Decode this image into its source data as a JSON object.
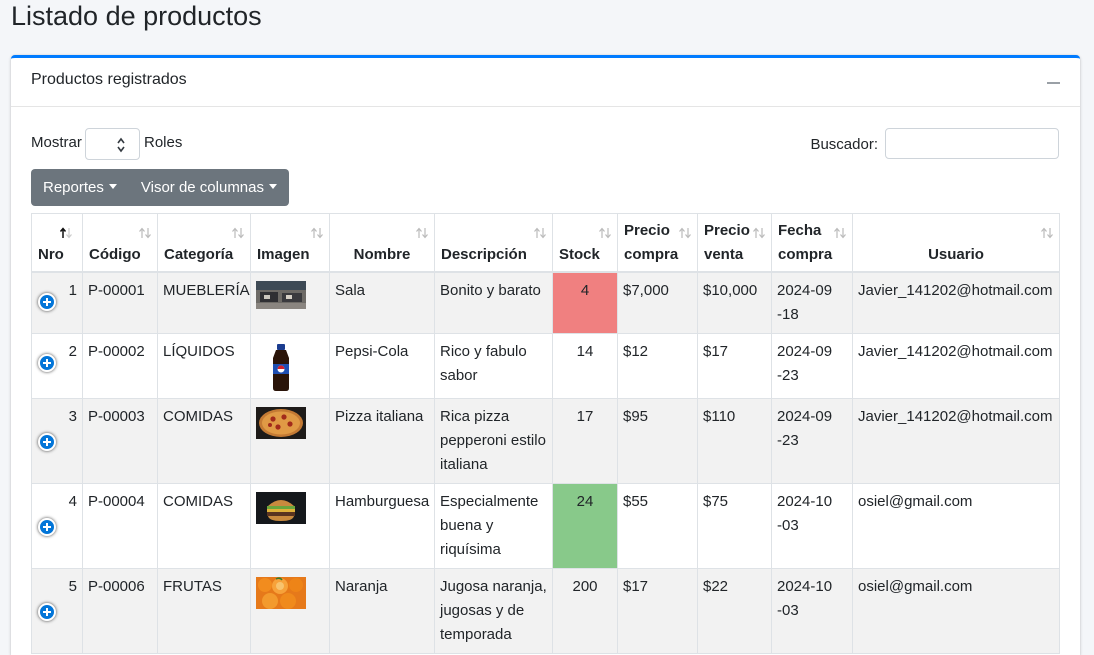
{
  "page": {
    "title": "Listado de productos"
  },
  "card": {
    "title": "Productos registrados"
  },
  "controls": {
    "show_label": "Mostrar",
    "roles_label": "Roles",
    "search_label": "Buscador:",
    "search_value": ""
  },
  "buttons": {
    "reports": "Reportes",
    "column_viewer": "Visor de columnas"
  },
  "colors": {
    "accent": "#007bff",
    "btn": "#6c757d",
    "stock_low": "#f08080",
    "stock_high": "#88c98a"
  },
  "table": {
    "headers": {
      "nro": "Nro",
      "codigo": "Código",
      "categoria": "Categoría",
      "imagen": "Imagen",
      "nombre": "Nombre",
      "descripcion": "Descripción",
      "stock": "Stock",
      "precio_compra_1": "Precio",
      "precio_compra_2": "compra",
      "precio_venta_1": "Precio",
      "precio_venta_2": "venta",
      "fecha_compra_1": "Fecha",
      "fecha_compra_2": "compra",
      "usuario": "Usuario"
    },
    "rows": [
      {
        "nro": "1",
        "codigo": "P-00001",
        "categoria": "MUEBLERÍA",
        "image": "sofa-image",
        "nombre": "Sala",
        "descripcion": "Bonito y barato",
        "stock": "4",
        "stock_state": "low",
        "precio_compra": "$7,000",
        "precio_venta": "$10,000",
        "fecha": "2024-09-18",
        "usuario": "Javier_141202@hotmail.com"
      },
      {
        "nro": "2",
        "codigo": "P-00002",
        "categoria": "LÍQUIDOS",
        "image": "bottle-image",
        "nombre": "Pepsi-Cola",
        "descripcion": "Rico y fabulo sabor",
        "stock": "14",
        "stock_state": "normal",
        "precio_compra": "$12",
        "precio_venta": "$17",
        "fecha": "2024-09-23",
        "usuario": "Javier_141202@hotmail.com"
      },
      {
        "nro": "3",
        "codigo": "P-00003",
        "categoria": "COMIDAS",
        "image": "pizza-image",
        "nombre": "Pizza italiana",
        "descripcion": "Rica pizza pepperoni estilo italiana",
        "stock": "17",
        "stock_state": "normal",
        "precio_compra": "$95",
        "precio_venta": "$110",
        "fecha": "2024-09-23",
        "usuario": "Javier_141202@hotmail.com"
      },
      {
        "nro": "4",
        "codigo": "P-00004",
        "categoria": "COMIDAS",
        "image": "burger-image",
        "nombre": "Hamburguesa",
        "descripcion": "Especialmente buena y riquísima",
        "stock": "24",
        "stock_state": "high",
        "precio_compra": "$55",
        "precio_venta": "$75",
        "fecha": "2024-10-03",
        "usuario": "osiel@gmail.com"
      },
      {
        "nro": "5",
        "codigo": "P-00006",
        "categoria": "FRUTAS",
        "image": "orange-image",
        "nombre": "Naranja",
        "descripcion": "Jugosa naranja, jugosas y de temporada",
        "stock": "200",
        "stock_state": "normal",
        "precio_compra": "$17",
        "precio_venta": "$22",
        "fecha": "2024-10-03",
        "usuario": "osiel@gmail.com"
      }
    ]
  }
}
